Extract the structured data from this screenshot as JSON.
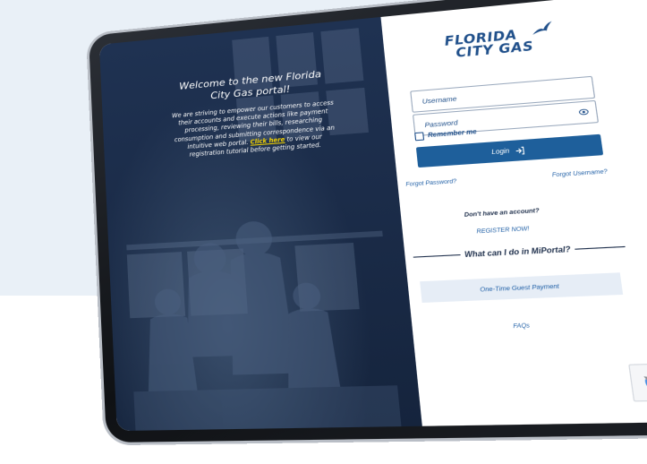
{
  "login_page": {
    "welcome": {
      "title": "Welcome to the new Florida City Gas portal!",
      "body": "We are striving to empower our customers to access their accounts and execute actions like payment processing, reviewing their bills, researching consumption and submitting correspondence via an intuitive web portal.",
      "link_text": "Click here",
      "link_suffix": "to view our registration tutorial before getting started."
    },
    "logo": {
      "line1": "FLORIDA",
      "line2": "CITY GAS"
    },
    "username_placeholder": "Username",
    "password_placeholder": "Password",
    "remember_label": "Remember me",
    "login_label": "Login",
    "forgot_password": "Forgot Password?",
    "forgot_username": "Forgot Username?",
    "no_account": "Don't have an account?",
    "register": "REGISTER NOW!",
    "section_title": "What can I do in MiPortal?",
    "guest_payment": "One-Time Guest Payment",
    "faqs": "FAQs"
  },
  "colors": {
    "brand_blue": "#1e5f9b",
    "navy_panel": "#1b2c49",
    "link_yellow": "#f5d400",
    "page_tint": "#e9f0f7"
  },
  "icons": [
    "eye-icon",
    "login-arrow-icon",
    "bird-logo-icon",
    "recaptcha-icon"
  ]
}
